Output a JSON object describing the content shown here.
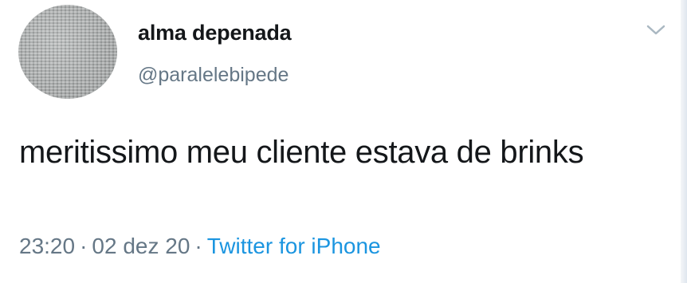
{
  "author": {
    "display_name": "alma depenada",
    "handle": "@paralelebipede",
    "avatar_icon": "avatar-image"
  },
  "tweet": {
    "text": "meritissimo meu cliente estava de brinks",
    "time": "23:20",
    "separator_1": "·",
    "date": "02 dez 20",
    "separator_2": "·",
    "source": "Twitter for iPhone"
  },
  "menu": {
    "icon": "chevron-down-icon"
  },
  "colors": {
    "text": "#14171a",
    "secondary": "#657786",
    "link": "#1b95e0",
    "chevron": "#aab8c2"
  }
}
